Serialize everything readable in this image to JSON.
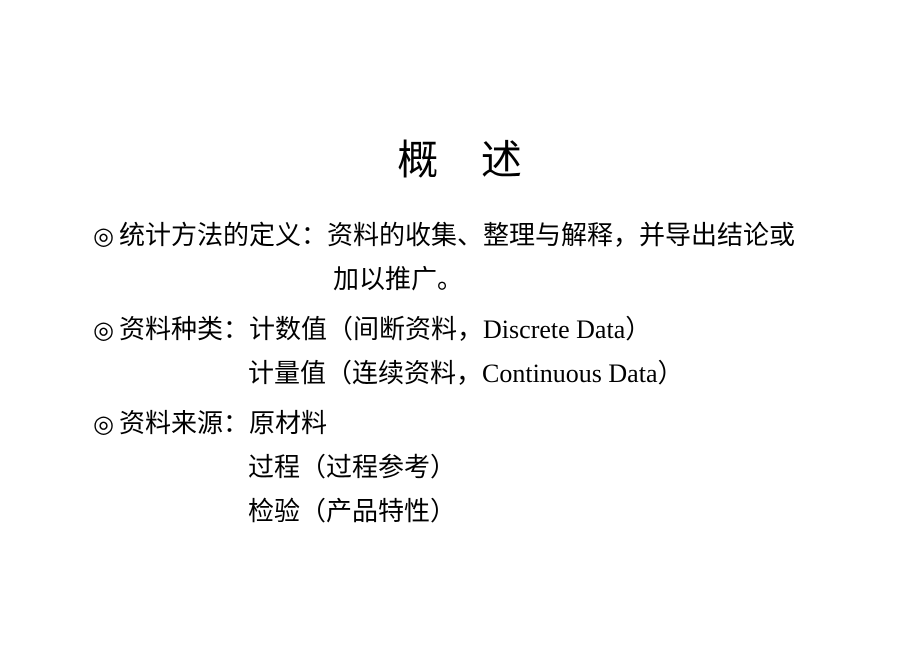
{
  "slide": {
    "title": "概　述",
    "background_color": "#ffffff",
    "text_color": "#000000",
    "bullet_marker": "◎",
    "sections": [
      {
        "label": "统计方法的定义",
        "separator": "：",
        "first_line": "资料的收集、整理与解释，并导出结论或",
        "wrapped_lines": [
          "加以推广。"
        ],
        "continuation_lines": []
      },
      {
        "label": "资料种类",
        "separator": "：",
        "first_line": "计数值（间断资料，Discrete Data）",
        "wrapped_lines": [],
        "continuation_lines": [
          "计量值（连续资料，Continuous Data）"
        ]
      },
      {
        "label": "资料来源",
        "separator": "：",
        "first_line": "原材料",
        "wrapped_lines": [],
        "continuation_lines": [
          "过程（过程参考）",
          "检验（产品特性）"
        ]
      }
    ]
  }
}
